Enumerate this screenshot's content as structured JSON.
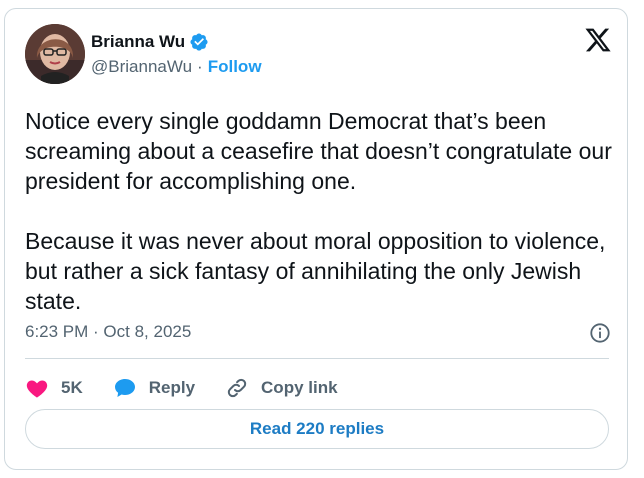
{
  "author": {
    "name": "Brianna Wu",
    "handle": "@BriannaWu",
    "separator": "·",
    "follow_label": "Follow"
  },
  "tweet": {
    "text": "Notice every single goddamn Democrat that’s been screaming about a ceasefire that doesn’t congratulate our president for accomplishing one.\n\nBecause it was never about moral opposition to violence, but rather a sick fantasy of annihilating the only Jewish state.",
    "timestamp": "6:23 PM · Oct 8, 2025"
  },
  "actions": {
    "like_count": "5K",
    "reply_label": "Reply",
    "copy_link_label": "Copy link"
  },
  "read_replies_label": "Read 220 replies",
  "icons": {
    "verified": "verified-badge-icon",
    "logo": "x-logo-icon",
    "info": "info-icon",
    "like": "heart-icon",
    "reply": "speech-bubble-icon",
    "link": "link-icon"
  },
  "colors": {
    "accent": "#1d9bf0",
    "like": "#f91880",
    "text": "#0f1419",
    "muted": "#536471",
    "border": "#cfd9de"
  }
}
